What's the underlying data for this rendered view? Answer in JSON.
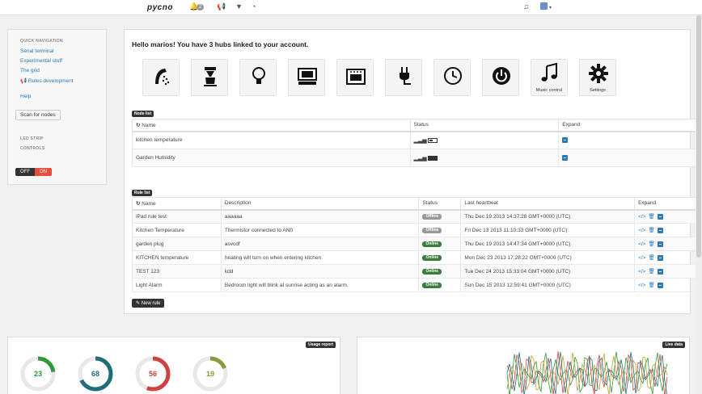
{
  "topbar": {
    "logo": "pycno",
    "notification_count": "2"
  },
  "sidebar": {
    "quick_nav_header": "QUICK NAVIGATION",
    "links": [
      "Serial terminal",
      "Experimental stuff",
      "The grid",
      "Rules development",
      "Help"
    ],
    "scan_button": "Scan for nodes",
    "led_strip_header": "LED STRIP",
    "controls_header": "CONTROLS",
    "off_label": "OFF",
    "on_label": "ON"
  },
  "main": {
    "greeting": "Hello marios! You have 3 hubs linked to your account.",
    "tiles": [
      {
        "icon": "shower-icon",
        "caption": ""
      },
      {
        "icon": "coffee-maker-icon",
        "caption": ""
      },
      {
        "icon": "light-bulb-icon",
        "caption": ""
      },
      {
        "icon": "tv-set-icon",
        "caption": ""
      },
      {
        "icon": "oven-icon",
        "caption": ""
      },
      {
        "icon": "plug-icon",
        "caption": ""
      },
      {
        "icon": "clock-icon",
        "caption": ""
      },
      {
        "icon": "power-icon",
        "caption": ""
      },
      {
        "icon": "music-icon",
        "caption": "Music control"
      },
      {
        "icon": "gear-icon",
        "caption": "Settings"
      }
    ],
    "node_list": {
      "label": "Node list",
      "headers": [
        "Name",
        "Status",
        "Expand"
      ],
      "rows": [
        {
          "name": "kitchen temperature"
        },
        {
          "name": "Garden Humidity"
        }
      ]
    },
    "rule_list": {
      "label": "Rule list",
      "headers": [
        "Name",
        "Description",
        "Status",
        "Last heartbeat",
        "Expand"
      ],
      "rows": [
        {
          "name": "iPad rule test",
          "description": "aaaaaa",
          "status": "Offline",
          "heartbeat": "Thu Dec 19 2013 14:37:28 GMT+0000 (UTC)"
        },
        {
          "name": "Kitchen Temperature",
          "description": "Thermistor connected to AN0",
          "status": "Offline",
          "heartbeat": "Fri Dec 13 2013 11:10:33 GMT+0000 (UTC)"
        },
        {
          "name": "garden plug",
          "description": "asvcdf",
          "status": "Online",
          "heartbeat": "Thu Dec 19 2013 14:47:34 GMT+0000 (UTC)"
        },
        {
          "name": "KITCHEN temperature",
          "description": "heating will turn on when entering kitchen",
          "status": "Online",
          "heartbeat": "Mon Dec 23 2013 17:28:22 GMT+0000 (UTC)"
        },
        {
          "name": "TEST 123",
          "description": "kdd",
          "status": "Online",
          "heartbeat": "Tue Dec 24 2013 15:33:04 GMT+0000 (UTC)"
        },
        {
          "name": "Light Alarm",
          "description": "Bedroom light will blink at sunrise acting as an alarm.",
          "status": "Online",
          "heartbeat": "Sun Dec 15 2013 12:59:41 GMT+0000 (UTC)"
        }
      ]
    },
    "new_rule_button": "New rule"
  },
  "usage_report": {
    "label": "Usage report",
    "gauges": [
      {
        "value": "23",
        "fraction": 0.23,
        "color": "#2e9a3a"
      },
      {
        "value": "68",
        "fraction": 0.68,
        "color": "#1f6f7a"
      },
      {
        "value": "56",
        "fraction": 0.56,
        "color": "#d04040"
      },
      {
        "value": "19",
        "fraction": 0.19,
        "color": "#8a9a3a"
      }
    ]
  },
  "live_data": {
    "label": "Live data"
  },
  "colors": {
    "online": "#3a7d3a",
    "offline": "#999999",
    "accent": "#2a7ab8",
    "danger": "#e74c3c"
  }
}
